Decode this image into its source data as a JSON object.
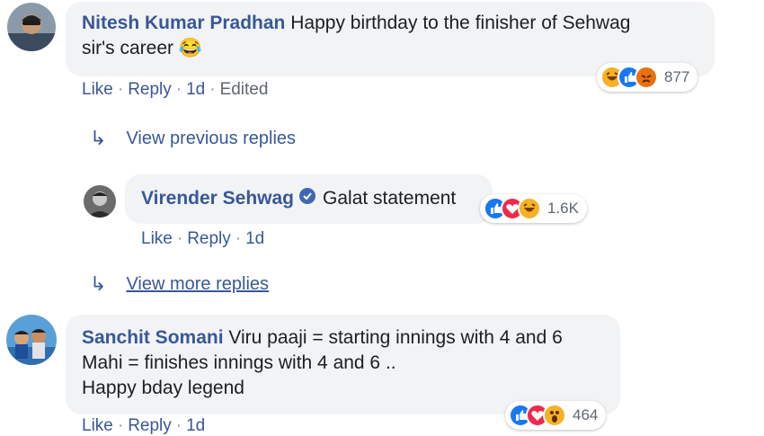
{
  "comments": [
    {
      "author": "Nitesh Kumar Pradhan",
      "text_line1": "Happy birthday to the finisher of Sehwag",
      "text_line2": "sir's career 😂",
      "actions": {
        "like": "Like",
        "reply": "Reply",
        "time": "1d",
        "edited": "Edited"
      },
      "reactions": {
        "icons": [
          "haha-icon",
          "like-icon",
          "angry-icon"
        ],
        "count": "877"
      }
    },
    {
      "author": "Sanchit Somani",
      "text_line1": "Viru paaji = starting innings with 4 and 6",
      "text_line2": "Mahi = finishes innings with 4 and 6 ..",
      "text_line3": "Happy bday legend",
      "actions": {
        "like": "Like",
        "reply": "Reply",
        "time": "1d"
      },
      "reactions": {
        "icons": [
          "like-icon",
          "love-icon",
          "wow-icon"
        ],
        "count": "464"
      }
    }
  ],
  "reply": {
    "author": "Virender Sehwag",
    "verified": true,
    "text": "Galat statement",
    "actions": {
      "like": "Like",
      "reply": "Reply",
      "time": "1d"
    },
    "reactions": {
      "icons": [
        "like-icon",
        "love-icon",
        "haha-icon"
      ],
      "count": "1.6K"
    }
  },
  "links": {
    "view_previous": "View previous replies",
    "view_more": "View more replies"
  },
  "colors": {
    "name": "#385898",
    "bubble": "#f2f3f5",
    "meta": "#606770",
    "like": "#1877f2",
    "love": "#f0284a",
    "haha": "#f7b125",
    "angry": "#e9710f"
  }
}
